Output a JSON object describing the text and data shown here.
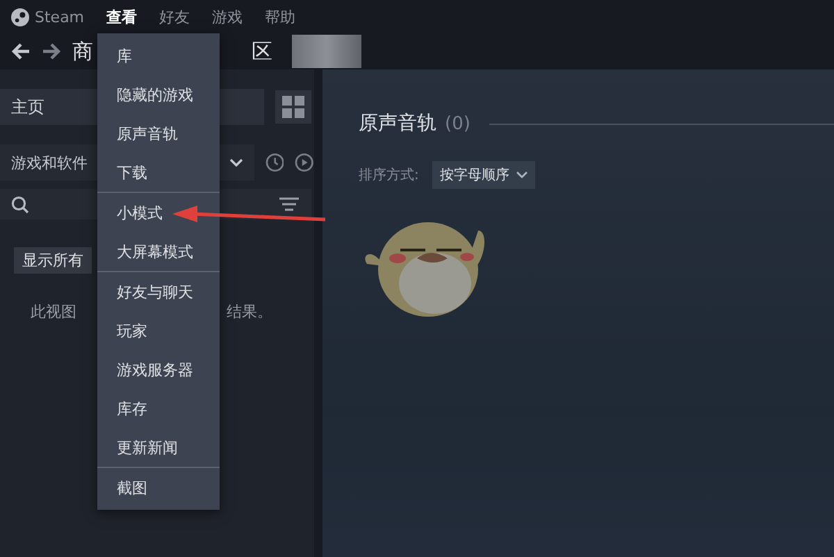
{
  "menubar": [
    {
      "label": "Steam",
      "selected": false,
      "kind": "logo"
    },
    {
      "label": "查看",
      "selected": true
    },
    {
      "label": "好友",
      "selected": false
    },
    {
      "label": "游戏",
      "selected": false
    },
    {
      "label": "帮助",
      "selected": false
    }
  ],
  "nav": {
    "title_start": "商",
    "title_end": "区"
  },
  "sidebar": {
    "home": "主页",
    "filter": "游戏和软件",
    "show_all": "显示所有",
    "empty_start": "此视图",
    "empty_end": "结果。"
  },
  "view_menu": {
    "groups": [
      [
        "库",
        "隐藏的游戏",
        "原声音轨",
        "下载"
      ],
      [
        "小模式",
        "大屏幕模式"
      ],
      [
        "好友与聊天",
        "玩家",
        "游戏服务器",
        "库存",
        "更新新闻"
      ],
      [
        "截图"
      ]
    ]
  },
  "content": {
    "title": "原声音轨",
    "count": "(0)",
    "sort_label": "排序方式:",
    "sort_value": "按字母顺序"
  }
}
